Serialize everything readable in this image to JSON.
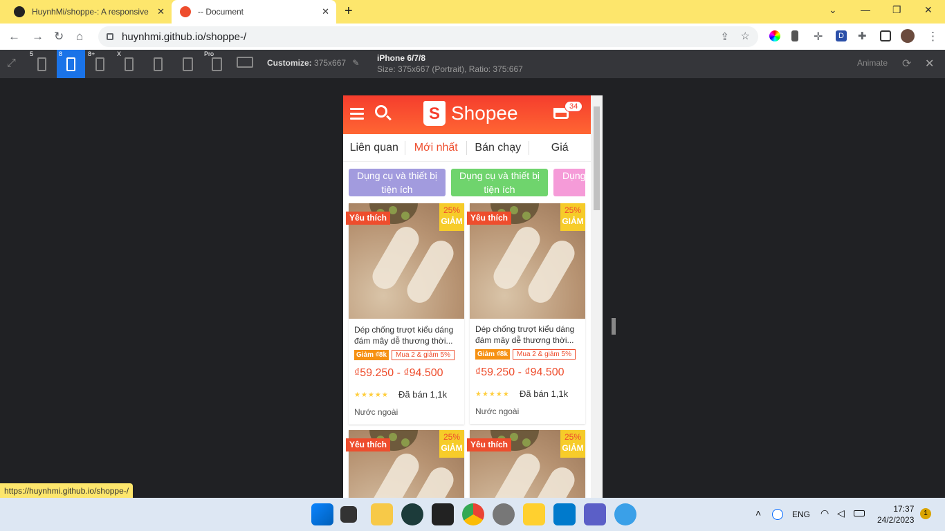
{
  "browser": {
    "tabs": [
      {
        "title": "HuynhMi/shoppe-: A responsive"
      },
      {
        "title": "-- Document"
      }
    ],
    "url": "huynhmi.github.io/shoppe-/",
    "status_url": "https://huynhmi.github.io/shoppe-/"
  },
  "device_bar": {
    "devices": [
      "5",
      "8",
      "8+",
      "X",
      "",
      "",
      "Pro",
      ""
    ],
    "customize_label": "Customize:",
    "customize_value": "375x667",
    "device_name": "iPhone 6/7/8",
    "device_size": "Size: 375x667 (Portrait), Ratio: 375:667",
    "animate_label": "Animate"
  },
  "shopee": {
    "logo": "Shopee",
    "cart_count": "34",
    "sort_tabs": [
      "Liên quan",
      "Mới nhất",
      "Bán chạy",
      "Giá"
    ],
    "categories": [
      "Dụng cụ và thiết bị tiện ích",
      "Dụng cụ và thiết bị tiện ích",
      "Dụng"
    ],
    "products": [
      {
        "badge": "Yêu thích",
        "discount_pct": "25%",
        "discount_word": "GIẢM",
        "name": "Dép chống trượt kiểu dáng đám mây dễ thương thời...",
        "tag1": "Giảm ₫8k",
        "tag2": "Mua 2 & giảm 5%",
        "price": "₫59.250 - ₫94.500",
        "sold": "Đã bán 1,1k",
        "origin": "Nước ngoài"
      },
      {
        "badge": "Yêu thích",
        "discount_pct": "25%",
        "discount_word": "GIẢM",
        "name": "Dép chống trượt kiểu dáng đám mây dễ thương thời...",
        "tag1": "Giảm ₫8k",
        "tag2": "Mua 2 & giảm 5%",
        "price": "₫59.250 - ₫94.500",
        "sold": "Đã bán 1,1k",
        "origin": "Nước ngoài"
      },
      {
        "badge": "Yêu thích",
        "discount_pct": "25%",
        "discount_word": "GIẢM"
      },
      {
        "badge": "Yêu thích",
        "discount_pct": "25%",
        "discount_word": "GIẢM"
      }
    ]
  },
  "taskbar": {
    "lang": "ENG",
    "time": "17:37",
    "date": "24/2/2023",
    "notifications": "1"
  }
}
